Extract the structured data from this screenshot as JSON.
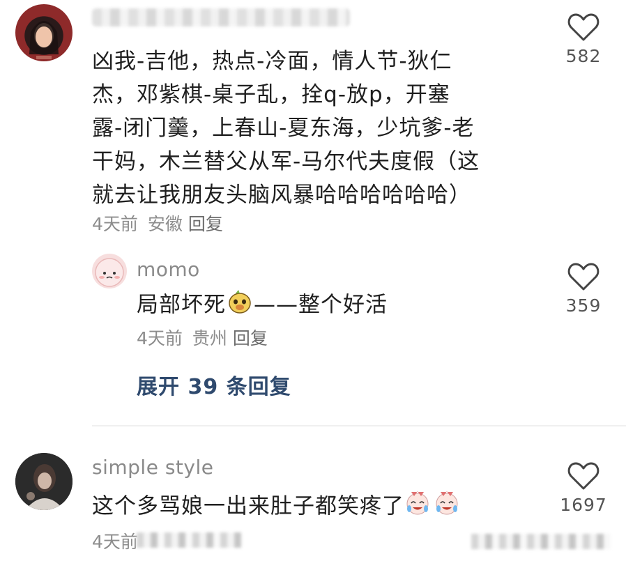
{
  "comments": [
    {
      "user": {
        "name": "",
        "avatar": "avatar-woman-red-bg"
      },
      "lines": [
        "凶我-吉他，热点-冷面，情人节-狄仁",
        "杰，邓紫棋-桌子乱，拴q-放p，开塞",
        "露-闭门羹，上春山-夏东海，少坑爹-老",
        "干妈，木兰替父从军-马尔代夫度假（这",
        "就去让我朋友头脑风暴哈哈哈哈哈哈）"
      ],
      "time": "4天前",
      "location": "安徽",
      "reply_label": "回复",
      "likes": "582",
      "replies": [
        {
          "user": {
            "name": "momo",
            "avatar": "avatar-pink-bun"
          },
          "text_before": "局部坏死",
          "emoji": "dog-face-emoji",
          "text_after": "——整个好活",
          "time": "4天前",
          "location": "贵州",
          "reply_label": "回复",
          "likes": "359"
        }
      ],
      "expand_label": "展开 39 条回复"
    },
    {
      "user": {
        "name": "simple style",
        "avatar": "avatar-dark-photo"
      },
      "text": "这个多骂娘一出来肚子都笑疼了",
      "emoji": "laughing-crying-emoji",
      "time": "4天前",
      "likes": "1697"
    }
  ],
  "colors": {
    "text": "#1f1f1f",
    "meta": "#8c8c8c",
    "expand": "#2f4a6e",
    "heart": "#444444"
  }
}
